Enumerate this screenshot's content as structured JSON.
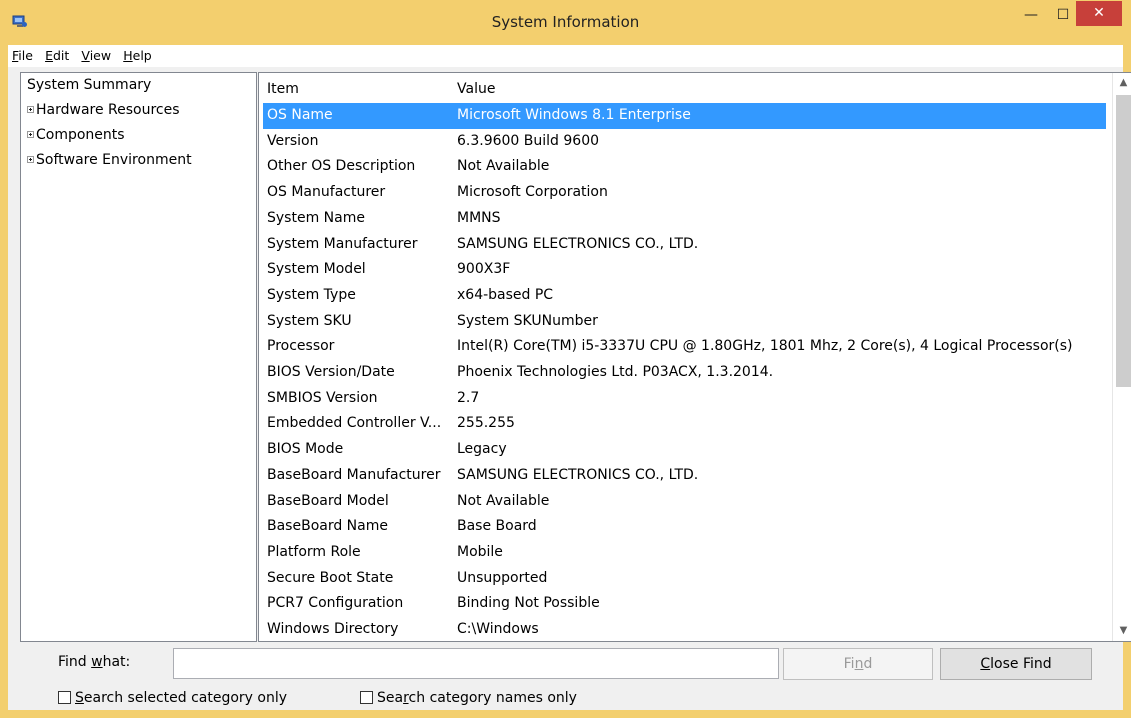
{
  "window": {
    "title": "System Information",
    "minimize": "—",
    "maximize": "☐",
    "close": "✕"
  },
  "menu": [
    {
      "pre": "",
      "key": "F",
      "rest": "ile"
    },
    {
      "pre": "",
      "key": "E",
      "rest": "dit"
    },
    {
      "pre": "",
      "key": "V",
      "rest": "iew"
    },
    {
      "pre": "",
      "key": "H",
      "rest": "elp"
    }
  ],
  "tree": {
    "root": "System Summary",
    "children": [
      "Hardware Resources",
      "Components",
      "Software Environment"
    ]
  },
  "list": {
    "columns": {
      "item": "Item",
      "value": "Value"
    },
    "rows": [
      {
        "item": "OS Name",
        "value": "Microsoft Windows 8.1 Enterprise"
      },
      {
        "item": "Version",
        "value": "6.3.9600 Build 9600"
      },
      {
        "item": "Other OS Description",
        "value": "Not Available"
      },
      {
        "item": "OS Manufacturer",
        "value": "Microsoft Corporation"
      },
      {
        "item": "System Name",
        "value": "MMNS"
      },
      {
        "item": "System Manufacturer",
        "value": "SAMSUNG ELECTRONICS CO., LTD."
      },
      {
        "item": "System Model",
        "value": "900X3F"
      },
      {
        "item": "System Type",
        "value": "x64-based PC"
      },
      {
        "item": "System SKU",
        "value": "System SKUNumber"
      },
      {
        "item": "Processor",
        "value": "Intel(R) Core(TM) i5-3337U CPU @ 1.80GHz, 1801 Mhz, 2 Core(s), 4 Logical Processor(s)"
      },
      {
        "item": "BIOS Version/Date",
        "value": "Phoenix Technologies Ltd. P03ACX, 1.3.2014."
      },
      {
        "item": "SMBIOS Version",
        "value": "2.7"
      },
      {
        "item": "Embedded Controller V...",
        "value": "255.255"
      },
      {
        "item": "BIOS Mode",
        "value": "Legacy"
      },
      {
        "item": "BaseBoard Manufacturer",
        "value": "SAMSUNG ELECTRONICS CO., LTD."
      },
      {
        "item": "BaseBoard Model",
        "value": "Not Available"
      },
      {
        "item": "BaseBoard Name",
        "value": "Base Board"
      },
      {
        "item": "Platform Role",
        "value": "Mobile"
      },
      {
        "item": "Secure Boot State",
        "value": "Unsupported"
      },
      {
        "item": "PCR7 Configuration",
        "value": "Binding Not Possible"
      },
      {
        "item": "Windows Directory",
        "value": "C:\\Windows"
      }
    ],
    "selected_index": 0
  },
  "find": {
    "label_pre": "Find ",
    "label_key": "w",
    "label_rest": "hat:",
    "input_value": "",
    "find_pre": "Fi",
    "find_key": "n",
    "find_rest": "d",
    "close_key": "C",
    "close_rest": "lose Find",
    "check1_key": "S",
    "check1_rest": "earch selected category only",
    "check2_pre": "Sea",
    "check2_key": "r",
    "check2_rest": "ch category names only"
  },
  "colors": {
    "title_bar": "#f3cf6e",
    "selection": "#3399ff",
    "close_button": "#c7403a"
  }
}
